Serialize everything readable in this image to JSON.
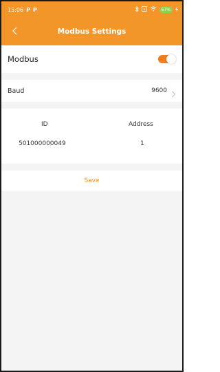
{
  "status_bar": {
    "time": "15:06",
    "indicator_p1": "P",
    "indicator_p2": "P",
    "battery": "67%"
  },
  "nav": {
    "title": "Modbus Settings"
  },
  "modbus": {
    "label": "Modbus",
    "enabled": true
  },
  "baud": {
    "label": "Baud",
    "value": "9600"
  },
  "table": {
    "columns": [
      "ID",
      "Address"
    ],
    "rows": [
      [
        "501000000049",
        "1"
      ]
    ]
  },
  "save_label": "Save",
  "colors": {
    "accent": "#f2962a",
    "toggle_on": "#f07d1e"
  }
}
